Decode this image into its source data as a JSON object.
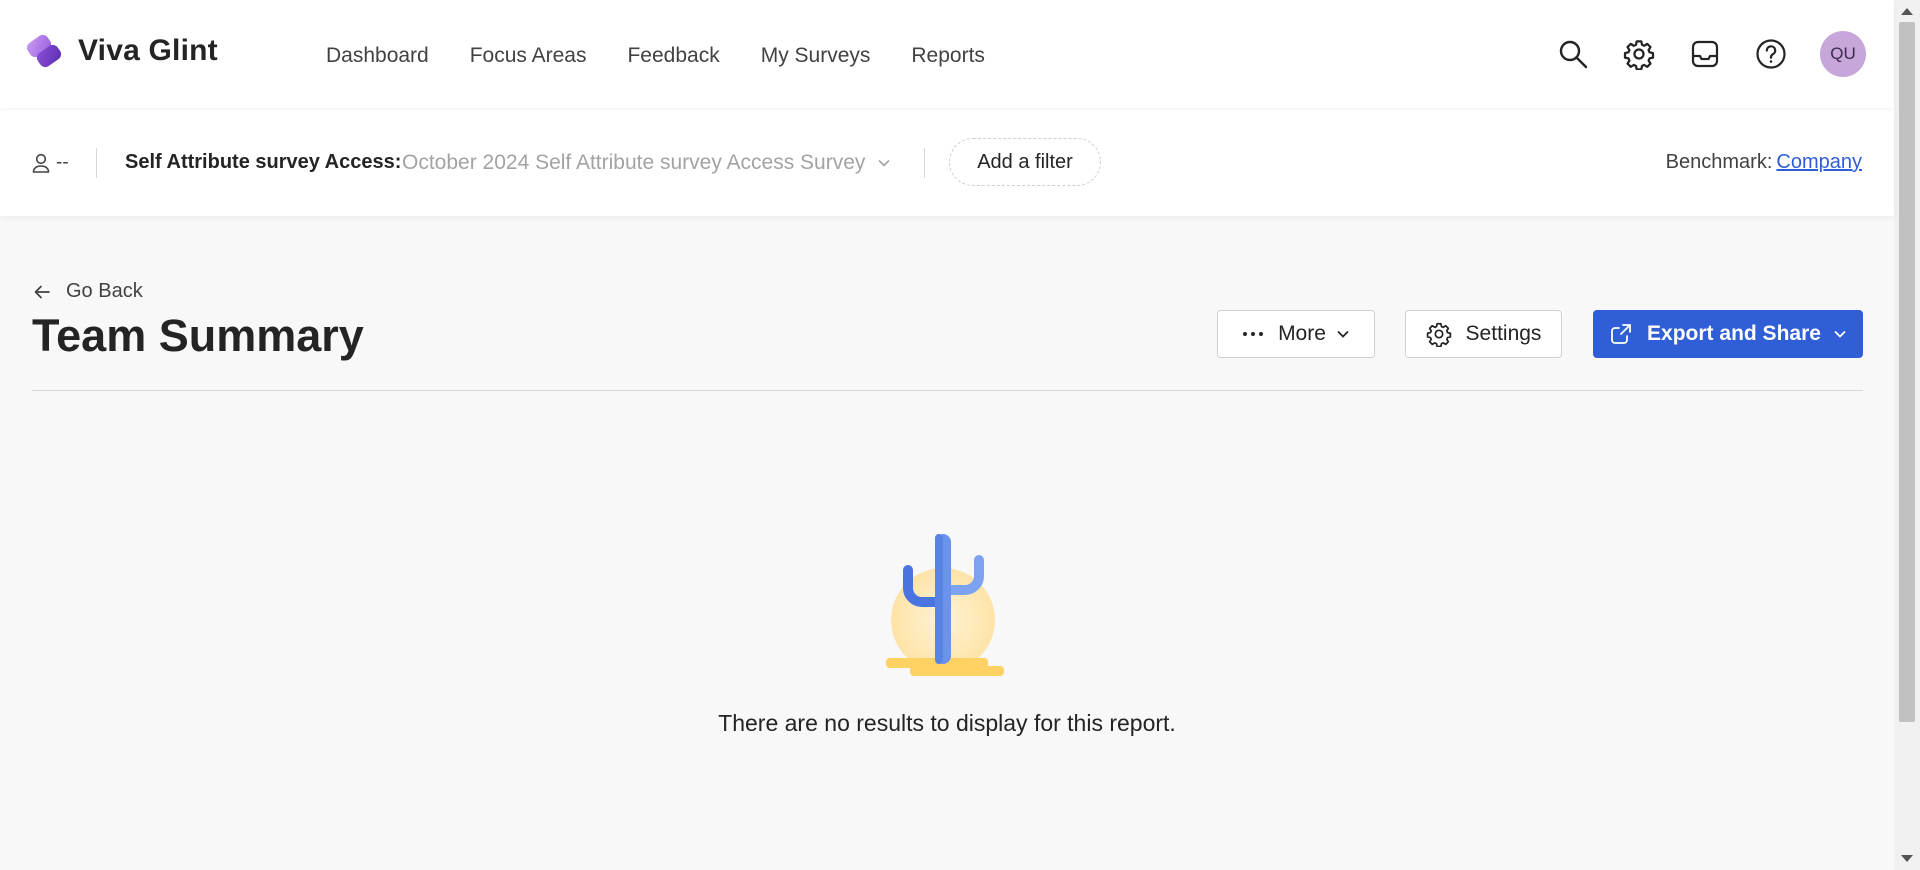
{
  "app": {
    "name": "Viva Glint"
  },
  "nav": {
    "items": [
      "Dashboard",
      "Focus Areas",
      "Feedback",
      "My Surveys",
      "Reports"
    ]
  },
  "topbar": {
    "avatar_initials": "QU",
    "icons": [
      "search-icon",
      "gear-icon",
      "inbox-icon",
      "help-icon"
    ]
  },
  "filters": {
    "person_value": "--",
    "survey_label": "Self Attribute survey Access:",
    "survey_value": "October 2024 Self Attribute survey Access Survey",
    "add_filter": "Add a filter",
    "benchmark_label": "Benchmark:",
    "benchmark_value": "Company"
  },
  "page": {
    "go_back": "Go Back",
    "title": "Team Summary",
    "more_label": "More",
    "settings_label": "Settings",
    "export_label": "Export and Share",
    "empty_message": "There are no results to display for this report."
  },
  "colors": {
    "accent": "#2f5ed6",
    "avatar": "#c7a6d9",
    "background": "#f8f8f8"
  }
}
